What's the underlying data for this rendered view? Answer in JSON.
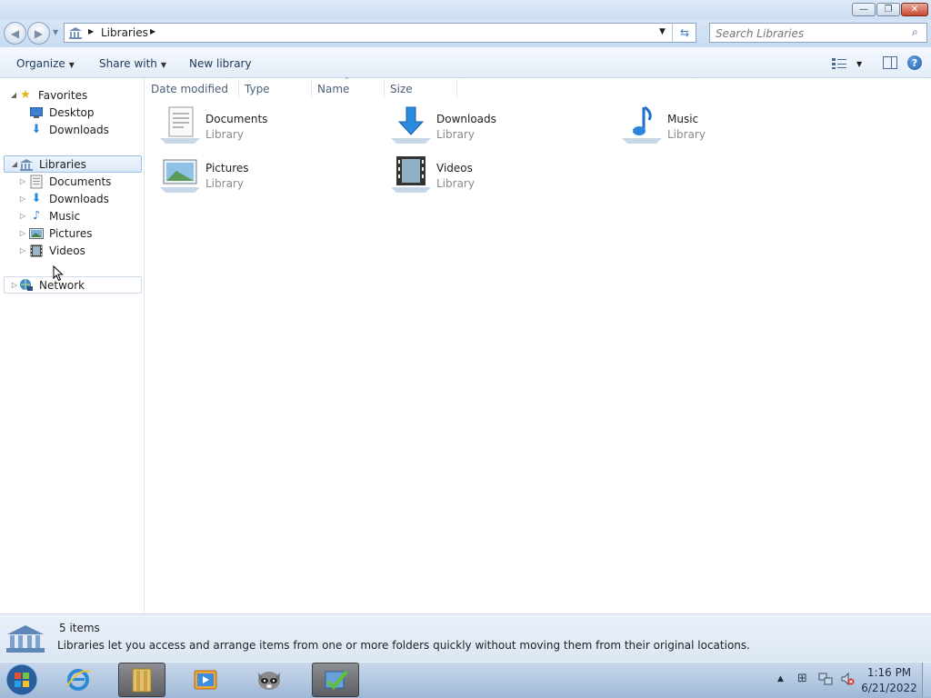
{
  "window": {
    "controls": {
      "minimize": "—",
      "maximize": "❐",
      "close": "✕"
    }
  },
  "address": {
    "crumb": "Libraries",
    "back_icon": "back-arrow-icon",
    "forward_icon": "forward-arrow-icon"
  },
  "search": {
    "placeholder": "Search Libraries"
  },
  "toolbar": {
    "organize": "Organize",
    "share_with": "Share with",
    "new_library": "New library"
  },
  "nav": {
    "favorites": {
      "label": "Favorites",
      "items": [
        {
          "label": "Desktop"
        },
        {
          "label": "Downloads"
        }
      ]
    },
    "libraries": {
      "label": "Libraries",
      "items": [
        {
          "label": "Documents"
        },
        {
          "label": "Downloads"
        },
        {
          "label": "Music"
        },
        {
          "label": "Pictures"
        },
        {
          "label": "Videos"
        }
      ]
    },
    "network": {
      "label": "Network"
    }
  },
  "columns": [
    "Date modified",
    "Type",
    "Name",
    "Size"
  ],
  "items": [
    {
      "name": "Documents",
      "kind": "Library"
    },
    {
      "name": "Downloads",
      "kind": "Library"
    },
    {
      "name": "Music",
      "kind": "Library"
    },
    {
      "name": "Pictures",
      "kind": "Library"
    },
    {
      "name": "Videos",
      "kind": "Library"
    }
  ],
  "details": {
    "count": "5 items",
    "description": "Libraries let you access and arrange items from one or more folders quickly without moving them from their original locations."
  },
  "taskbar": {
    "time": "1:16 PM",
    "date": "6/21/2022"
  },
  "colors": {
    "accent": "#1e395b",
    "selection": "#dce9f8",
    "taskbar": "#9fb8d6"
  }
}
